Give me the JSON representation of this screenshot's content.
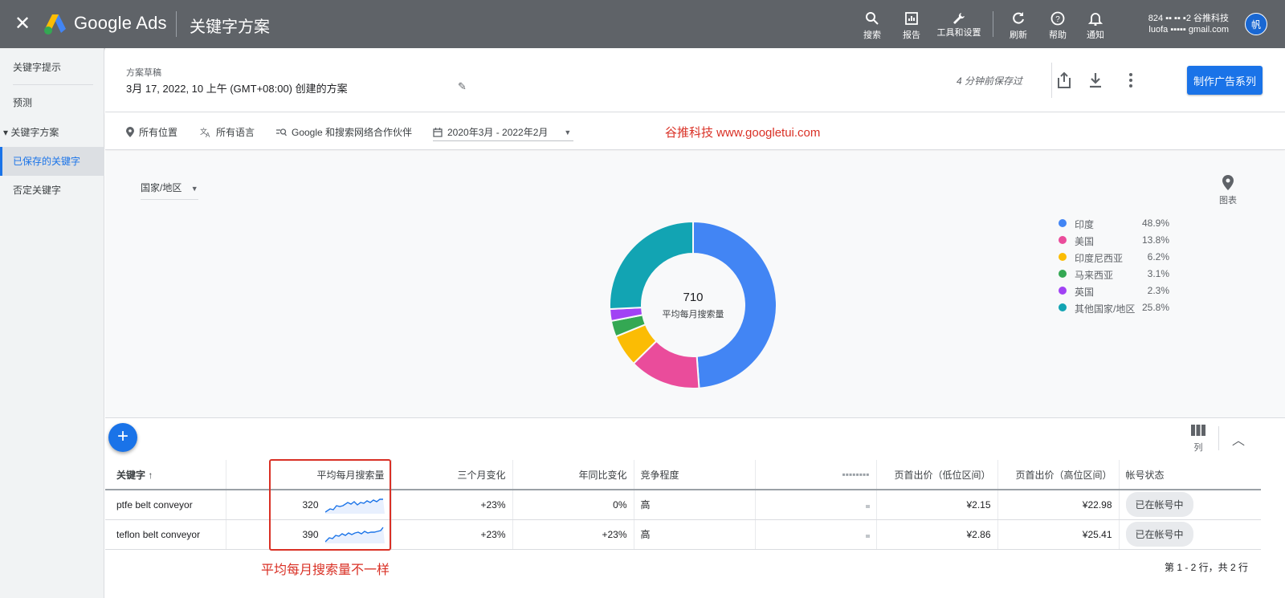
{
  "topbar": {
    "brand": "Google Ads",
    "page_title": "关键字方案",
    "actions": [
      {
        "label": "搜索",
        "icon": "search-icon"
      },
      {
        "label": "报告",
        "icon": "report-icon"
      },
      {
        "label": "工具和设置",
        "icon": "wrench-icon"
      },
      {
        "label": "刷新",
        "icon": "refresh-icon"
      },
      {
        "label": "帮助",
        "icon": "help-icon"
      },
      {
        "label": "通知",
        "icon": "bell-icon"
      }
    ],
    "account_line1": "824 ▪▪ ▪▪ ▪2 谷推科技",
    "account_line2": "luofa ▪▪▪▪▪ gmail.com",
    "avatar_initial": "帆"
  },
  "sidebar": {
    "items": [
      {
        "label": "关键字提示"
      },
      {
        "label": "预测"
      },
      {
        "label": "▾ 关键字方案"
      },
      {
        "label": "已保存的关键字"
      },
      {
        "label": "否定关键字"
      }
    ]
  },
  "header": {
    "label": "方案草稿",
    "title": "3月 17, 2022, 10 上午 (GMT+08:00) 创建的方案",
    "saved_status": "4 分钟前保存过",
    "cta": "制作广告系列"
  },
  "filters": {
    "location": "所有位置",
    "language": "所有语言",
    "network": "Google 和搜索网络合作伙伴",
    "date_range": "2020年3月 - 2022年2月"
  },
  "watermark": "谷推科技 www.googletui.com",
  "chart_panel": {
    "geo_select": "国家/地区",
    "map_button": "图表"
  },
  "chart_data": {
    "type": "pie",
    "center_value": "710",
    "center_label": "平均每月搜索量",
    "categories": [
      "印度",
      "美国",
      "印度尼西亚",
      "马来西亚",
      "英国",
      "其他国家/地区"
    ],
    "values": [
      48.9,
      13.8,
      6.2,
      3.1,
      2.3,
      25.8
    ],
    "value_labels": [
      "48.9%",
      "13.8%",
      "6.2%",
      "3.1%",
      "2.3%",
      "25.8%"
    ],
    "colors": [
      "#4285f4",
      "#ea4c9b",
      "#fbbc04",
      "#34a853",
      "#a142f4",
      "#12a4b3"
    ],
    "legend_position": "right"
  },
  "table": {
    "columns_button": "列",
    "headers": [
      "关键字 ↑",
      "",
      "平均每月搜索量",
      "三个月变化",
      "年同比变化",
      "竞争程度",
      "▪▪▪▪▪▪▪▪",
      "页首出价（低位区间）",
      "页首出价（高位区间）",
      "帐号状态"
    ],
    "rows": [
      {
        "keyword": "ptfe belt conveyor",
        "volume": "320",
        "three_month": "+23%",
        "yoy": "0%",
        "competition": "高",
        "low_bid": "¥2.15",
        "high_bid": "¥22.98",
        "status": "已在帐号中"
      },
      {
        "keyword": "teflon belt conveyor",
        "volume": "390",
        "three_month": "+23%",
        "yoy": "+23%",
        "competition": "高",
        "low_bid": "¥2.86",
        "high_bid": "¥25.41",
        "status": "已在帐号中"
      }
    ],
    "pager": "第 1 - 2 行，共 2 行"
  },
  "annotation": "平均每月搜索量不一样"
}
